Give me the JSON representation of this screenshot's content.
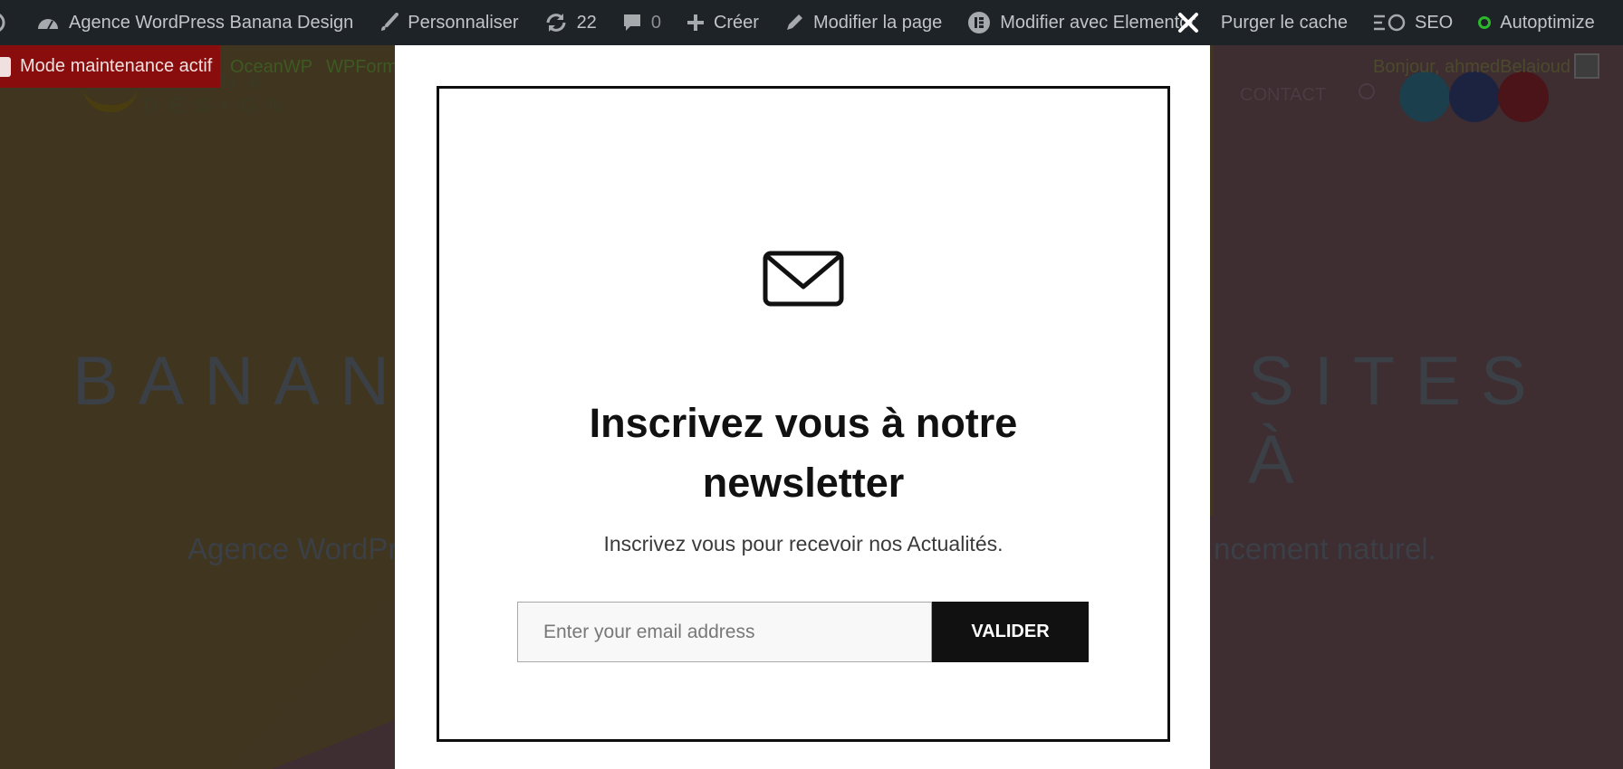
{
  "admin_bar": {
    "site_name": "Agence WordPress Banana Design",
    "customize": "Personnaliser",
    "updates_count": "22",
    "comments_count": "0",
    "new": "Créer",
    "edit_page": "Modifier la page",
    "elementor": "Modifier avec Elementor",
    "purge_cache": "Purger le cache",
    "seo": "SEO",
    "autoptimize": "Autoptimize"
  },
  "secondary_bar": {
    "maintenance": "Mode maintenance actif",
    "links": [
      "OceanWP",
      "WPForms"
    ],
    "greeting": "Bonjour, ahmedBelaioud"
  },
  "page": {
    "logo_line1": "NA",
    "logo_line2": "DESIGN",
    "nav_contact": "CONTACT",
    "hero_left": "BANANA",
    "hero_right": "SITES À",
    "sub_left": "Agence WordPr",
    "sub_right": "ncement naturel."
  },
  "modal": {
    "headline": "Inscrivez vous à notre newsletter",
    "subtext": "Inscrivez vous pour recevoir nos Actualités.",
    "email_placeholder": "Enter your email address",
    "submit_label": "VALIDER"
  },
  "colors": {
    "admin_bar": "#1d2327",
    "maintenance_bg": "#8a0d0d",
    "submit_bg": "#111111"
  }
}
